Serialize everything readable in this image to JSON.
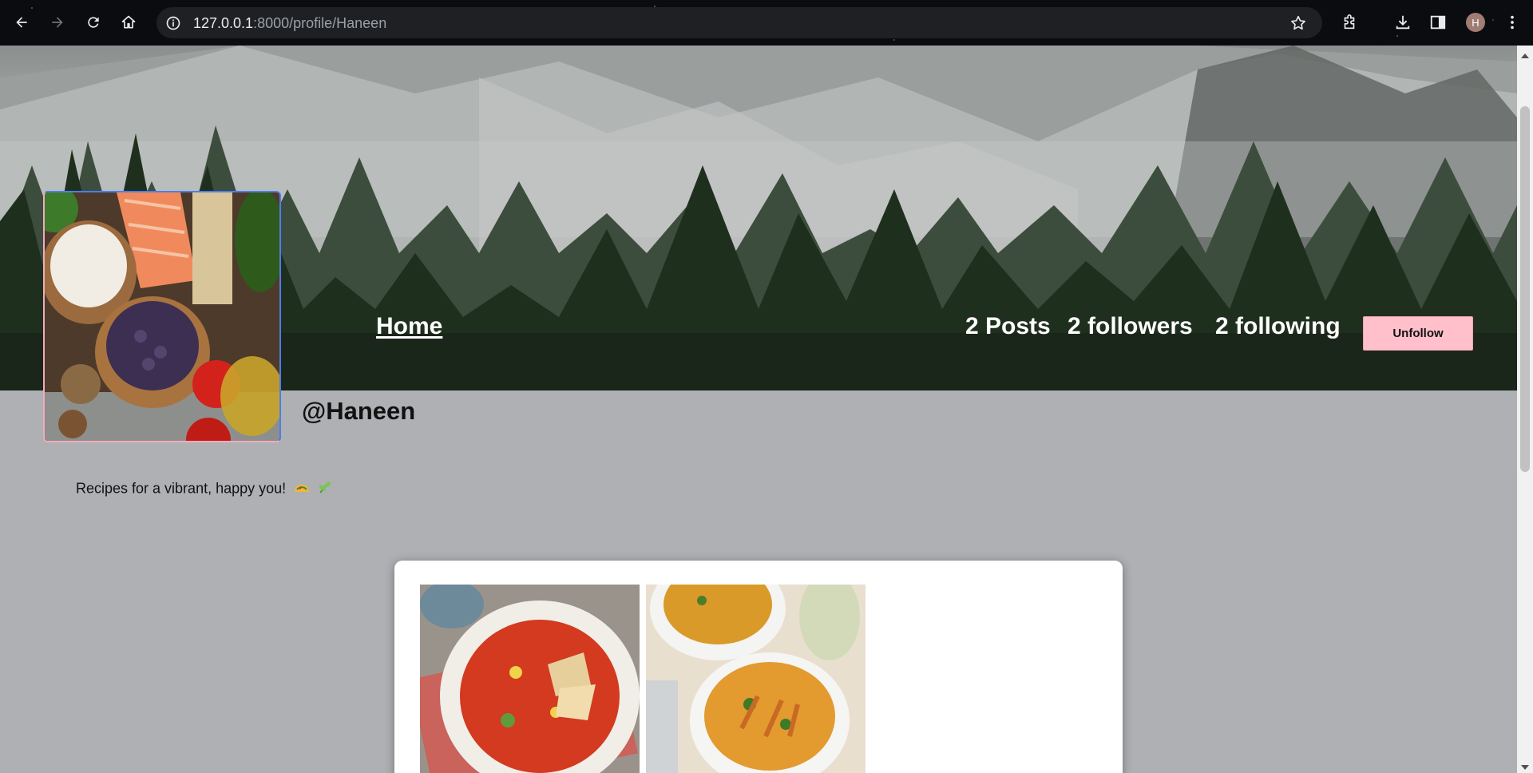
{
  "browser": {
    "url_host": "127.0.0.1",
    "url_rest": ":8000/profile/Haneen",
    "profile_initial": "H"
  },
  "nav": {
    "home_label": "Home"
  },
  "profile": {
    "posts_count": "2 Posts",
    "followers_count": "2 followers",
    "following_count": "2 following",
    "unfollow_label": "Unfollow",
    "username": "@Haneen",
    "bio": "Recipes for a vibrant, happy you!"
  },
  "colors": {
    "page_background": "#aeb0b3",
    "unfollow_button": "#ffc0cb",
    "card_background": "#ffffff"
  }
}
